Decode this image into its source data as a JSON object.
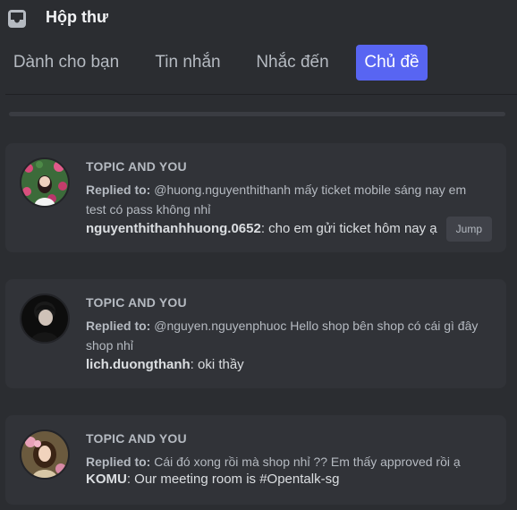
{
  "header": {
    "title": "Hộp thư",
    "icon": "inbox-icon"
  },
  "tabs": [
    {
      "label": "Dành cho bạn",
      "active": false
    },
    {
      "label": "Tin nhắn",
      "active": false
    },
    {
      "label": "Nhắc đến",
      "active": false
    },
    {
      "label": "Chủ đề",
      "active": true
    }
  ],
  "cards": [
    {
      "topic": "TOPIC AND YOU",
      "replied_label": "Replied to:",
      "replied_text": "@huong.nguyenthithanh mấy ticket mobile sáng nay em test có pass không nhỉ",
      "author": "nguyenthithanhhuong.0652",
      "message": ": cho em gửi ticket hôm nay ạ",
      "jump_label": "Jump"
    },
    {
      "topic": "TOPIC AND YOU",
      "replied_label": "Replied to:",
      "replied_text": "@nguyen.nguyenphuoc Hello shop bên shop có cái gì đây shop nhỉ",
      "author": "lich.duongthanh",
      "message": ": oki thầy"
    },
    {
      "topic": "TOPIC AND YOU",
      "replied_label": "Replied to:",
      "replied_text": "Cái đó xong rồi mà shop nhỉ ?? Em thấy approved rồi ạ",
      "author": "KOMU",
      "message": ": Our meeting room is #Opentalk-sg"
    }
  ],
  "colors": {
    "background": "#2b2d31",
    "card": "#313338",
    "accent": "#5865f2"
  }
}
